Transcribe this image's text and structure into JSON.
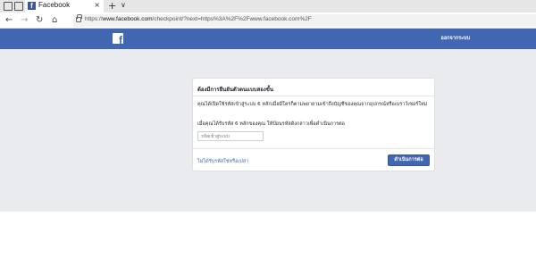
{
  "browser": {
    "tab": {
      "favicon": "f",
      "title": "Facebook",
      "close_glyph": "×"
    },
    "new_tab_glyph": "+",
    "tab_list_glyph": "∨",
    "nav": {
      "back": "←",
      "forward": "→",
      "refresh": "↻",
      "home": "⌂"
    },
    "url": {
      "prefix": "https://",
      "domain": "www.facebook.com",
      "rest": "/checkpoint/?next=https%3A%2F%2Fwww.facebook.com%2F"
    }
  },
  "header": {
    "logo": "f",
    "logout": "ออกจากระบบ"
  },
  "card": {
    "title": "ต้องมีการยืนยันตัวตนแบบสองขั้น",
    "description": "คุณได้เปิดใช้รหัสเข้าสู่ระบบ 6 หลักเมื่อมีใครก็ตามพยายามเข้าถึงบัญชีของคุณจากอุปกรณ์หรือเบราว์เซอร์ใหม่",
    "instruction": "เมื่อคุณได้รับรหัส 6 หลักของคุณ ให้ป้อนรหัสดังกล่าวเพื่อดำเนินการต่อ",
    "input_placeholder": "รหัสเข้าสู่ระบบ",
    "no_code_link": "ไม่ได้รับรหัสใช่หรือเปล่า",
    "continue_button": "ดำเนินการต่อ"
  },
  "colors": {
    "facebook_blue": "#4267b2",
    "page_background": "#e9ebee"
  }
}
